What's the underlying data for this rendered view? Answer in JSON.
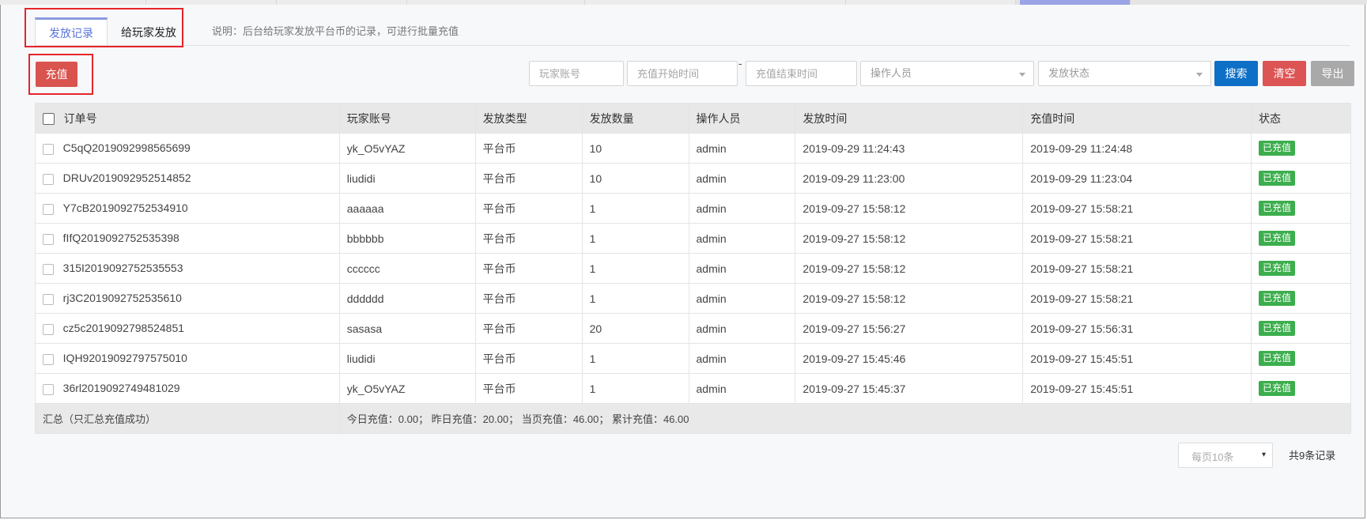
{
  "tabs": [
    {
      "label": "发放记录",
      "active": true
    },
    {
      "label": "给玩家发放",
      "active": false
    }
  ],
  "description": "说明：后台给玩家发放平台币的记录，可进行批量充值",
  "toolbar": {
    "charge_label": "充值",
    "account_placeholder": "玩家账号",
    "start_placeholder": "充值开始时间",
    "dash": "-",
    "end_placeholder": "充值结束时间",
    "operator_placeholder": "操作人员",
    "status_placeholder": "发放状态",
    "search_label": "搜索",
    "clear_label": "清空",
    "export_label": "导出"
  },
  "table": {
    "headers": [
      "订单号",
      "玩家账号",
      "发放类型",
      "发放数量",
      "操作人员",
      "发放时间",
      "充值时间",
      "状态"
    ],
    "rows": [
      [
        "C5qQ2019092998565699",
        "yk_O5vYAZ",
        "平台币",
        "10",
        "admin",
        "2019-09-29 11:24:43",
        "2019-09-29 11:24:48",
        "已充值"
      ],
      [
        "DRUv2019092952514852",
        "liudidi",
        "平台币",
        "10",
        "admin",
        "2019-09-29 11:23:00",
        "2019-09-29 11:23:04",
        "已充值"
      ],
      [
        "Y7cB2019092752534910",
        "aaaaaa",
        "平台币",
        "1",
        "admin",
        "2019-09-27 15:58:12",
        "2019-09-27 15:58:21",
        "已充值"
      ],
      [
        "fIfQ2019092752535398",
        "bbbbbb",
        "平台币",
        "1",
        "admin",
        "2019-09-27 15:58:12",
        "2019-09-27 15:58:21",
        "已充值"
      ],
      [
        "315I2019092752535553",
        "cccccc",
        "平台币",
        "1",
        "admin",
        "2019-09-27 15:58:12",
        "2019-09-27 15:58:21",
        "已充值"
      ],
      [
        "rj3C2019092752535610",
        "dddddd",
        "平台币",
        "1",
        "admin",
        "2019-09-27 15:58:12",
        "2019-09-27 15:58:21",
        "已充值"
      ],
      [
        "cz5c2019092798524851",
        "sasasa",
        "平台币",
        "20",
        "admin",
        "2019-09-27 15:56:27",
        "2019-09-27 15:56:31",
        "已充值"
      ],
      [
        "IQH92019092797575010",
        "liudidi",
        "平台币",
        "1",
        "admin",
        "2019-09-27 15:45:46",
        "2019-09-27 15:45:51",
        "已充值"
      ],
      [
        "36rl2019092749481029",
        "yk_O5vYAZ",
        "平台币",
        "1",
        "admin",
        "2019-09-27 15:45:37",
        "2019-09-27 15:45:51",
        "已充值"
      ]
    ],
    "summary_label": "汇总（只汇总充值成功）",
    "summary_text": "今日充值：0.00； 昨日充值：20.00； 当页充值：46.00； 累计充值：46.00"
  },
  "pager": {
    "per_page": "每页10条",
    "caret": "▾",
    "total": "共9条记录"
  },
  "colors": {
    "charge": "#d9534f",
    "search": "#0e6fc7",
    "clear": "#dc5454",
    "export": "#a9a9a9",
    "badge": "#3cae4d",
    "highlight": "#e5242b"
  }
}
